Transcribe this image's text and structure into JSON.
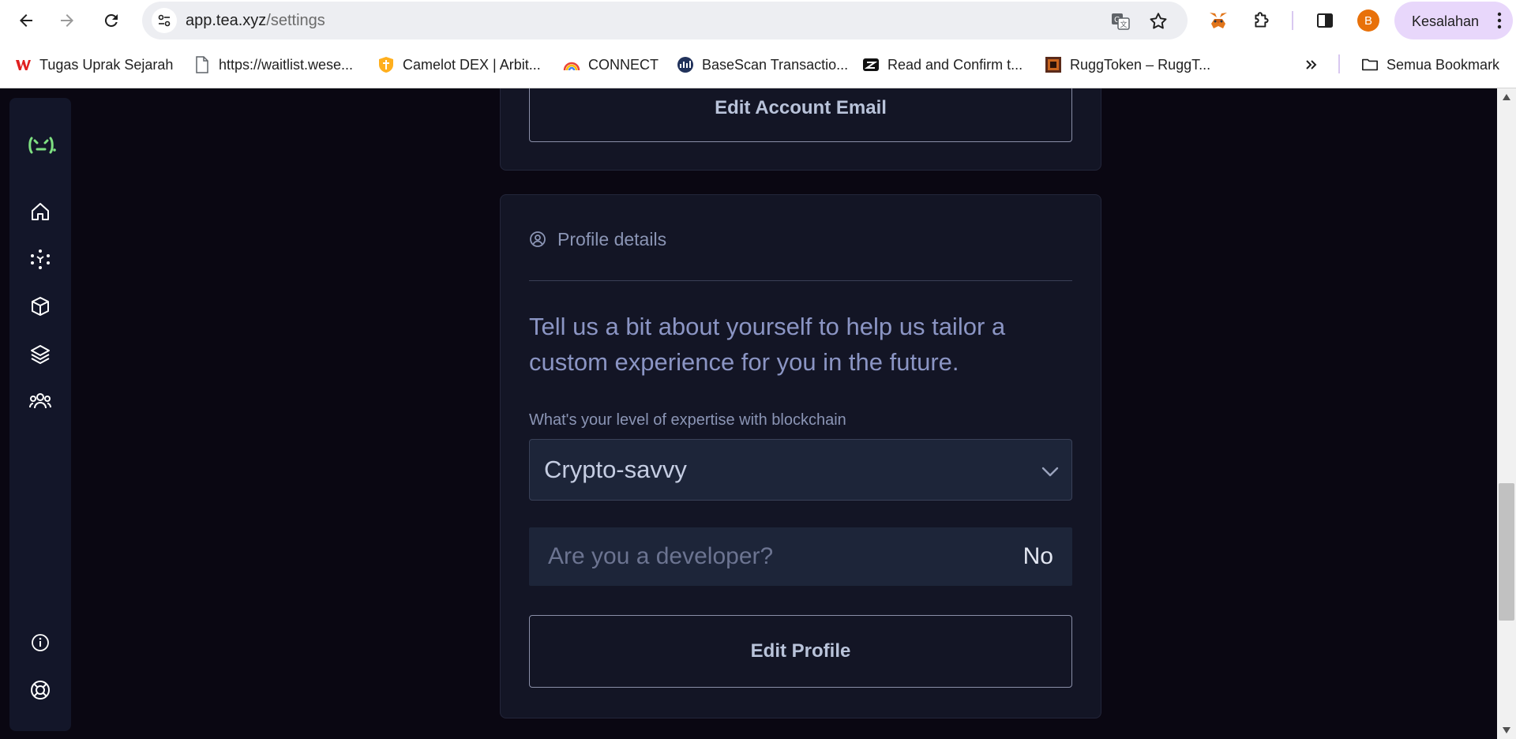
{
  "browser": {
    "url_domain": "app.tea.xyz",
    "url_path": "/settings",
    "profile_label": "Kesalahan",
    "avatar_letter": "B",
    "nav": {
      "back": "back-icon",
      "forward": "forward-icon",
      "reload": "reload-icon"
    },
    "omnibox_icons": [
      "translate-icon",
      "star-icon"
    ],
    "extensions": [
      "metamask-icon",
      "puzzle-icon",
      "side-panel-icon"
    ]
  },
  "bookmarks": {
    "items": [
      {
        "label": "Tugas Uprak Sejarah",
        "icon": "wps-icon"
      },
      {
        "label": "https://waitlist.wese...",
        "icon": "page-icon"
      },
      {
        "label": "Camelot DEX | Arbit...",
        "icon": "camelot-shield-icon"
      },
      {
        "label": "CONNECT",
        "icon": "rainbow-icon"
      },
      {
        "label": "BaseScan Transactio...",
        "icon": "basescan-icon"
      },
      {
        "label": "Read and Confirm t...",
        "icon": "zealy-icon"
      },
      {
        "label": "RuggToken – RuggT...",
        "icon": "rugg-icon"
      }
    ],
    "overflow_icon": "chevron-double-right-icon",
    "all_bookmarks_label": "Semua Bookmark"
  },
  "sidebar": {
    "logo": "tea-logo-icon",
    "items": [
      "home-icon",
      "network-icon",
      "package-icon",
      "layers-icon",
      "community-icon"
    ],
    "bottom": [
      "info-icon",
      "help-lifebuoy-icon"
    ]
  },
  "account_card": {
    "edit_email_label": "Edit Account Email"
  },
  "profile_card": {
    "heading": "Profile details",
    "intro": "Tell us a bit about yourself to help us tailor a custom experience for you in the future.",
    "expertise_label": "What's your level of expertise with blockchain",
    "expertise_value": "Crypto-savvy",
    "developer_question": "Are you a developer?",
    "developer_answer": "No",
    "edit_profile_label": "Edit Profile"
  },
  "colors": {
    "page_bg": "#0a0712",
    "card_bg": "#131525",
    "sidebar_bg": "#131629",
    "accent_green": "#7ee081",
    "muted_text": "#8b95b5"
  }
}
